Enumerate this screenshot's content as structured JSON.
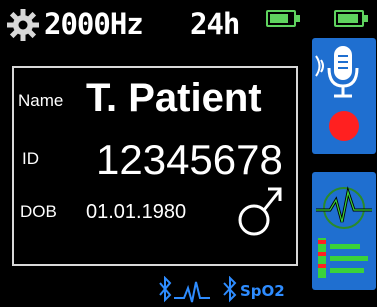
{
  "status": {
    "sample_rate": "2000Hz",
    "duration": "24h",
    "battery_1_level": 0.8,
    "battery_2_level": 0.9,
    "colors": {
      "battery": "#5fd35f",
      "bluetooth": "#2e8cff",
      "tile": "#1f6fd0"
    }
  },
  "patient": {
    "name_label": "Name",
    "name": "T. Patient",
    "id_label": "ID",
    "id": "12345678",
    "dob_label": "DOB",
    "dob": "01.01.1980",
    "sex_icon": "male-symbol-icon"
  },
  "tiles": {
    "record_icon": "microphone-record-icon",
    "ecg_icon": "ecg-levels-icon"
  },
  "footer": {
    "spo2_label": "SpO2",
    "ecg_bt_icon": "bluetooth-ecg-icon",
    "spo2_bt_icon": "bluetooth-icon"
  }
}
